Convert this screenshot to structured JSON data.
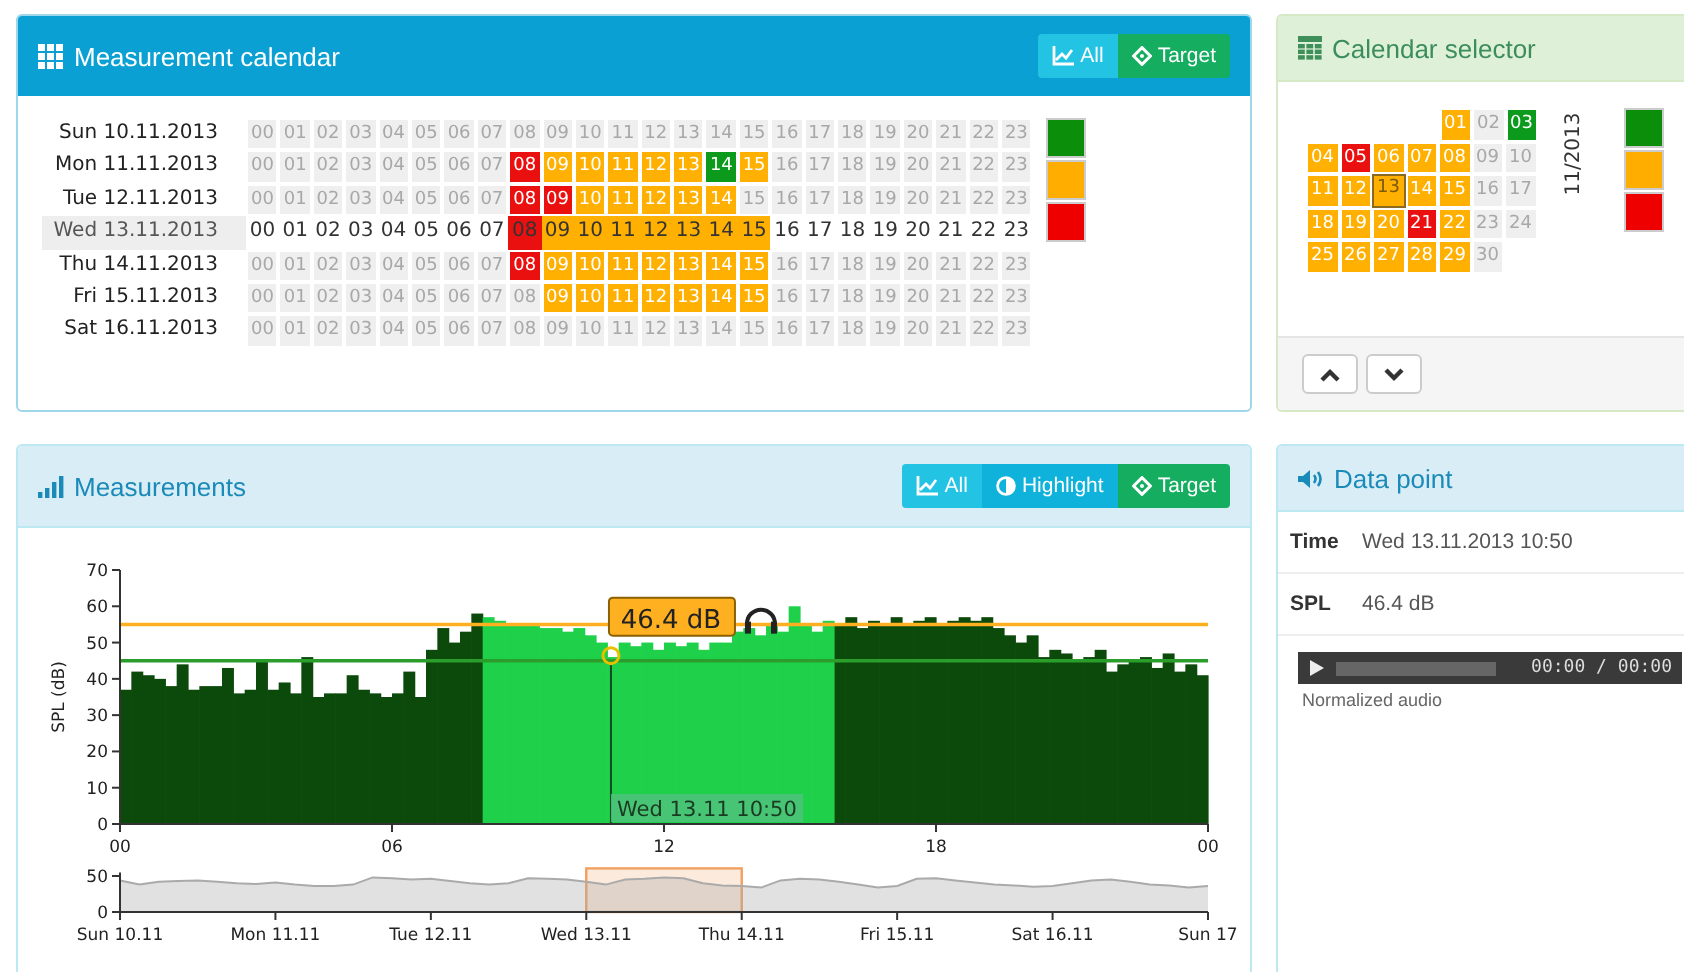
{
  "calendar": {
    "title": "Measurement calendar",
    "buttons": [
      {
        "label": "All",
        "kind": "all"
      },
      {
        "label": "Target",
        "kind": "target"
      }
    ],
    "days": [
      {
        "label": "Sun 10.11.2013",
        "selected": false,
        "cells": [
          {
            "label": "00"
          },
          {
            "label": "01"
          },
          {
            "label": "02"
          },
          {
            "label": "03"
          },
          {
            "label": "04"
          },
          {
            "label": "05"
          },
          {
            "label": "06"
          },
          {
            "label": "07"
          },
          {
            "label": "08"
          },
          {
            "label": "09"
          },
          {
            "label": "10"
          },
          {
            "label": "11"
          },
          {
            "label": "12"
          },
          {
            "label": "13"
          },
          {
            "label": "14"
          },
          {
            "label": "15"
          },
          {
            "label": "16"
          },
          {
            "label": "17"
          },
          {
            "label": "18"
          },
          {
            "label": "19"
          },
          {
            "label": "20"
          },
          {
            "label": "21"
          },
          {
            "label": "22"
          },
          {
            "label": "23"
          }
        ]
      },
      {
        "label": "Mon 11.11.2013",
        "selected": false,
        "cells": [
          {
            "label": "00"
          },
          {
            "label": "01"
          },
          {
            "label": "02"
          },
          {
            "label": "03"
          },
          {
            "label": "04"
          },
          {
            "label": "05"
          },
          {
            "label": "06"
          },
          {
            "label": "07"
          },
          {
            "label": "08",
            "color": "#ea1010"
          },
          {
            "label": "09",
            "color": "#ffb000"
          },
          {
            "label": "10",
            "color": "#ffb000"
          },
          {
            "label": "11",
            "color": "#ffb000"
          },
          {
            "label": "12",
            "color": "#ffb000"
          },
          {
            "label": "13",
            "color": "#ffb000"
          },
          {
            "label": "14",
            "color": "#0c9a1c"
          },
          {
            "label": "15",
            "color": "#ffb000"
          },
          {
            "label": "16"
          },
          {
            "label": "17"
          },
          {
            "label": "18"
          },
          {
            "label": "19"
          },
          {
            "label": "20"
          },
          {
            "label": "21"
          },
          {
            "label": "22"
          },
          {
            "label": "23"
          }
        ]
      },
      {
        "label": "Tue 12.11.2013",
        "selected": false,
        "cells": [
          {
            "label": "00"
          },
          {
            "label": "01"
          },
          {
            "label": "02"
          },
          {
            "label": "03"
          },
          {
            "label": "04"
          },
          {
            "label": "05"
          },
          {
            "label": "06"
          },
          {
            "label": "07"
          },
          {
            "label": "08",
            "color": "#ea1010"
          },
          {
            "label": "09",
            "color": "#ea1010"
          },
          {
            "label": "10",
            "color": "#ffb000"
          },
          {
            "label": "11",
            "color": "#ffb000"
          },
          {
            "label": "12",
            "color": "#ffb000"
          },
          {
            "label": "13",
            "color": "#ffb000"
          },
          {
            "label": "14",
            "color": "#ffb000"
          },
          {
            "label": "15"
          },
          {
            "label": "16"
          },
          {
            "label": "17"
          },
          {
            "label": "18"
          },
          {
            "label": "19"
          },
          {
            "label": "20"
          },
          {
            "label": "21"
          },
          {
            "label": "22"
          },
          {
            "label": "23"
          }
        ]
      },
      {
        "label": "Wed 13.11.2013",
        "selected": true,
        "cells": [
          {
            "label": "00"
          },
          {
            "label": "01"
          },
          {
            "label": "02"
          },
          {
            "label": "03"
          },
          {
            "label": "04"
          },
          {
            "label": "05"
          },
          {
            "label": "06"
          },
          {
            "label": "07"
          },
          {
            "label": "08",
            "color": "#ea1010"
          },
          {
            "label": "09",
            "color": "#ffb000"
          },
          {
            "label": "10",
            "color": "#ffb000"
          },
          {
            "label": "11",
            "color": "#ffb000"
          },
          {
            "label": "12",
            "color": "#ffb000"
          },
          {
            "label": "13",
            "color": "#ffb000"
          },
          {
            "label": "14",
            "color": "#ffb000"
          },
          {
            "label": "15",
            "color": "#ffb000"
          },
          {
            "label": "16"
          },
          {
            "label": "17"
          },
          {
            "label": "18"
          },
          {
            "label": "19"
          },
          {
            "label": "20"
          },
          {
            "label": "21"
          },
          {
            "label": "22"
          },
          {
            "label": "23"
          }
        ]
      },
      {
        "label": "Thu 14.11.2013",
        "selected": false,
        "cells": [
          {
            "label": "00"
          },
          {
            "label": "01"
          },
          {
            "label": "02"
          },
          {
            "label": "03"
          },
          {
            "label": "04"
          },
          {
            "label": "05"
          },
          {
            "label": "06"
          },
          {
            "label": "07"
          },
          {
            "label": "08",
            "color": "#ea1010"
          },
          {
            "label": "09",
            "color": "#ffb000"
          },
          {
            "label": "10",
            "color": "#ffb000"
          },
          {
            "label": "11",
            "color": "#ffb000"
          },
          {
            "label": "12",
            "color": "#ffb000"
          },
          {
            "label": "13",
            "color": "#ffb000"
          },
          {
            "label": "14",
            "color": "#ffb000"
          },
          {
            "label": "15",
            "color": "#ffb000"
          },
          {
            "label": "16"
          },
          {
            "label": "17"
          },
          {
            "label": "18"
          },
          {
            "label": "19"
          },
          {
            "label": "20"
          },
          {
            "label": "21"
          },
          {
            "label": "22"
          },
          {
            "label": "23"
          }
        ]
      },
      {
        "label": "Fri 15.11.2013",
        "selected": false,
        "cells": [
          {
            "label": "00"
          },
          {
            "label": "01"
          },
          {
            "label": "02"
          },
          {
            "label": "03"
          },
          {
            "label": "04"
          },
          {
            "label": "05"
          },
          {
            "label": "06"
          },
          {
            "label": "07"
          },
          {
            "label": "08"
          },
          {
            "label": "09",
            "color": "#ffb000"
          },
          {
            "label": "10",
            "color": "#ffb000"
          },
          {
            "label": "11",
            "color": "#ffb000"
          },
          {
            "label": "12",
            "color": "#ffb000"
          },
          {
            "label": "13",
            "color": "#ffb000"
          },
          {
            "label": "14",
            "color": "#ffb000"
          },
          {
            "label": "15",
            "color": "#ffb000"
          },
          {
            "label": "16"
          },
          {
            "label": "17"
          },
          {
            "label": "18"
          },
          {
            "label": "19"
          },
          {
            "label": "20"
          },
          {
            "label": "21"
          },
          {
            "label": "22"
          },
          {
            "label": "23"
          }
        ]
      },
      {
        "label": "Sat 16.11.2013",
        "selected": false,
        "cells": [
          {
            "label": "00"
          },
          {
            "label": "01"
          },
          {
            "label": "02"
          },
          {
            "label": "03"
          },
          {
            "label": "04"
          },
          {
            "label": "05"
          },
          {
            "label": "06"
          },
          {
            "label": "07"
          },
          {
            "label": "08"
          },
          {
            "label": "09"
          },
          {
            "label": "10"
          },
          {
            "label": "11"
          },
          {
            "label": "12"
          },
          {
            "label": "13"
          },
          {
            "label": "14"
          },
          {
            "label": "15"
          },
          {
            "label": "16"
          },
          {
            "label": "17"
          },
          {
            "label": "18"
          },
          {
            "label": "19"
          },
          {
            "label": "20"
          },
          {
            "label": "21"
          },
          {
            "label": "22"
          },
          {
            "label": "23"
          }
        ]
      }
    ],
    "legend": [
      {
        "color": "#0b8f0b"
      },
      {
        "color": "#ffae00"
      },
      {
        "color": "#ee0000"
      }
    ]
  },
  "selector": {
    "title": "Calendar selector",
    "month": "11/2013",
    "weeks": [
      [
        {
          "label": "01",
          "color": "#ffb000",
          "selected": false
        },
        {
          "label": "02",
          "selected": false
        },
        {
          "label": "03",
          "color": "#0c9a1c",
          "selected": false
        }
      ],
      [
        {
          "label": "04",
          "color": "#ffb000",
          "selected": false
        },
        {
          "label": "05",
          "color": "#ea1010",
          "selected": false
        },
        {
          "label": "06",
          "color": "#ffb000",
          "selected": false
        },
        {
          "label": "07",
          "color": "#ffb000",
          "selected": false
        },
        {
          "label": "08",
          "color": "#ffb000",
          "selected": false
        },
        {
          "label": "09",
          "selected": false
        },
        {
          "label": "10",
          "selected": false
        }
      ],
      [
        {
          "label": "11",
          "color": "#ffb000",
          "selected": false
        },
        {
          "label": "12",
          "color": "#ffb000",
          "selected": false
        },
        {
          "label": "13",
          "color": "#ffb000",
          "selected": true
        },
        {
          "label": "14",
          "color": "#ffb000",
          "selected": false
        },
        {
          "label": "15",
          "color": "#ffb000",
          "selected": false
        },
        {
          "label": "16",
          "selected": false
        },
        {
          "label": "17",
          "selected": false
        }
      ],
      [
        {
          "label": "18",
          "color": "#ffb000",
          "selected": false
        },
        {
          "label": "19",
          "color": "#ffb000",
          "selected": false
        },
        {
          "label": "20",
          "color": "#ffb000",
          "selected": false
        },
        {
          "label": "21",
          "color": "#ea1010",
          "selected": false
        },
        {
          "label": "22",
          "color": "#ffb000",
          "selected": false
        },
        {
          "label": "23",
          "selected": false
        },
        {
          "label": "24",
          "selected": false
        }
      ],
      [
        {
          "label": "25",
          "color": "#ffb000",
          "selected": false
        },
        {
          "label": "26",
          "color": "#ffb000",
          "selected": false
        },
        {
          "label": "27",
          "color": "#ffb000",
          "selected": false
        },
        {
          "label": "28",
          "color": "#ffb000",
          "selected": false
        },
        {
          "label": "29",
          "color": "#ffb000",
          "selected": false
        },
        {
          "label": "30",
          "selected": false
        }
      ]
    ],
    "legend": [
      {
        "color": "#0b8f0b"
      },
      {
        "color": "#ffae00"
      },
      {
        "color": "#ee0000"
      }
    ]
  },
  "measurements": {
    "title": "Measurements",
    "buttons": [
      {
        "label": "All",
        "kind": "all"
      },
      {
        "label": "Highlight",
        "kind": "highlight"
      },
      {
        "label": "Target",
        "kind": "target"
      }
    ],
    "cursor_time": "Wed 13.11 10:50",
    "chart_data": {
      "type": "bar",
      "ylabel": "SPL (dB)",
      "xlim": [
        0,
        24
      ],
      "ylim": [
        0,
        70
      ],
      "yticks": [
        0,
        10,
        20,
        30,
        40,
        50,
        60,
        70
      ],
      "xticks": [
        {
          "value": 0,
          "label": "00"
        },
        {
          "value": 6,
          "label": "06"
        },
        {
          "value": 12,
          "label": "12"
        },
        {
          "value": 18,
          "label": "18"
        },
        {
          "value": 24,
          "label": "00"
        }
      ],
      "x": [
        0,
        0.25,
        0.5,
        0.75,
        1,
        1.25,
        1.5,
        1.75,
        2,
        2.25,
        2.5,
        2.75,
        3,
        3.25,
        3.5,
        3.75,
        4,
        4.25,
        4.5,
        4.75,
        5,
        5.25,
        5.5,
        5.75,
        6,
        6.25,
        6.5,
        6.75,
        7,
        7.25,
        7.5,
        7.75,
        8,
        8.25,
        8.5,
        8.75,
        9,
        9.25,
        9.5,
        9.75,
        10,
        10.25,
        10.5,
        10.75,
        11,
        11.25,
        11.5,
        11.75,
        12,
        12.25,
        12.5,
        12.75,
        13,
        13.25,
        13.5,
        13.75,
        14,
        14.25,
        14.5,
        14.75,
        15,
        15.25,
        15.5,
        15.75,
        16,
        16.25,
        16.5,
        16.75,
        17,
        17.25,
        17.5,
        17.75,
        18,
        18.25,
        18.5,
        18.75,
        19,
        19.25,
        19.5,
        19.75,
        20,
        20.25,
        20.5,
        20.75,
        21,
        21.25,
        21.5,
        21.75,
        22,
        22.25,
        22.5,
        22.75,
        23,
        23.25,
        23.5,
        23.75
      ],
      "series": [
        {
          "color": "#0b4a0b",
          "values": [
            37,
            42,
            41,
            40,
            38,
            44,
            37,
            38,
            38,
            43,
            36,
            37,
            45,
            37,
            39,
            36,
            46,
            35,
            36,
            36,
            41,
            37,
            36,
            35,
            36,
            42,
            35,
            48,
            54,
            50,
            53,
            58,
            null,
            null,
            null,
            null,
            null,
            null,
            null,
            null,
            null,
            null,
            null,
            null,
            null,
            null,
            null,
            null,
            null,
            null,
            null,
            null,
            null,
            null,
            null,
            null,
            null,
            null,
            null,
            null,
            null,
            null,
            null,
            55,
            57,
            54,
            56,
            55,
            57,
            55,
            56,
            57,
            55,
            56,
            57,
            56,
            57,
            54,
            52,
            50,
            52,
            46,
            48,
            47,
            45,
            46,
            48,
            42,
            44,
            45,
            46,
            43,
            47,
            42,
            44,
            41
          ]
        },
        {
          "color": "#1fd04a",
          "values": [
            null,
            null,
            null,
            null,
            null,
            null,
            null,
            null,
            null,
            null,
            null,
            null,
            null,
            null,
            null,
            null,
            null,
            null,
            null,
            null,
            null,
            null,
            null,
            null,
            null,
            null,
            null,
            null,
            null,
            null,
            null,
            null,
            57,
            56,
            55,
            55,
            55,
            54,
            54,
            53,
            54,
            52,
            50,
            46,
            50,
            49,
            50,
            48,
            50,
            49,
            50,
            48,
            50,
            50,
            53,
            54,
            52,
            55,
            53,
            60,
            55,
            53,
            56,
            null,
            null,
            null,
            null,
            null,
            null,
            null,
            null,
            null,
            null,
            null,
            null,
            null,
            null,
            null,
            null,
            null,
            null,
            null,
            null,
            null,
            null,
            null,
            null,
            null,
            null,
            null,
            null,
            null,
            null,
            null,
            null,
            null
          ]
        }
      ],
      "ref_lines": [
        {
          "axis": "y",
          "value": 55,
          "color": "#ffb020"
        },
        {
          "axis": "y",
          "value": 45,
          "color": "#2a9d2a"
        }
      ],
      "annotations": [
        {
          "x": 10.83,
          "y": 46.4,
          "text": "46.4 dB"
        }
      ]
    },
    "overview": {
      "chart_data": {
        "type": "area",
        "ylim": [
          0,
          55
        ],
        "yticks": [
          0,
          50
        ],
        "categories": [
          "Sun 10.11",
          null,
          null,
          null,
          null,
          null,
          null,
          null,
          "Mon 11.11",
          null,
          null,
          null,
          null,
          null,
          null,
          null,
          "Tue 12.11",
          null,
          null,
          null,
          null,
          null,
          null,
          null,
          "Wed 13.11",
          null,
          null,
          null,
          null,
          null,
          null,
          null,
          "Thu 14.11",
          null,
          null,
          null,
          null,
          null,
          null,
          null,
          "Fri 15.11",
          null,
          null,
          null,
          null,
          null,
          null,
          null,
          "Sat 16.11",
          null,
          null,
          null,
          null,
          null,
          null,
          null,
          "Sun 17"
        ],
        "series": [
          {
            "color": "#aaaaaa",
            "values": [
              44,
              38,
              42,
              43,
              44,
              42,
              40,
              39,
              41,
              38,
              36,
              36,
              38,
              48,
              47,
              45,
              46,
              43,
              40,
              38,
              40,
              47,
              46,
              45,
              42,
              38,
              45,
              46,
              48,
              47,
              40,
              37,
              36,
              34,
              44,
              46,
              45,
              42,
              38,
              34,
              36,
              46,
              47,
              44,
              41,
              38,
              37,
              35,
              36,
              40,
              44,
              45,
              42,
              38,
              37,
              34,
              36
            ]
          }
        ]
      }
    }
  },
  "datapoint": {
    "title": "Data point",
    "fields": [
      {
        "label": "Time",
        "value": "Wed 13.11.2013 10:50"
      },
      {
        "label": "SPL",
        "value": "46.4 dB"
      }
    ],
    "player": {
      "time": "00:00 / 00:00",
      "caption": "Normalized audio"
    }
  }
}
